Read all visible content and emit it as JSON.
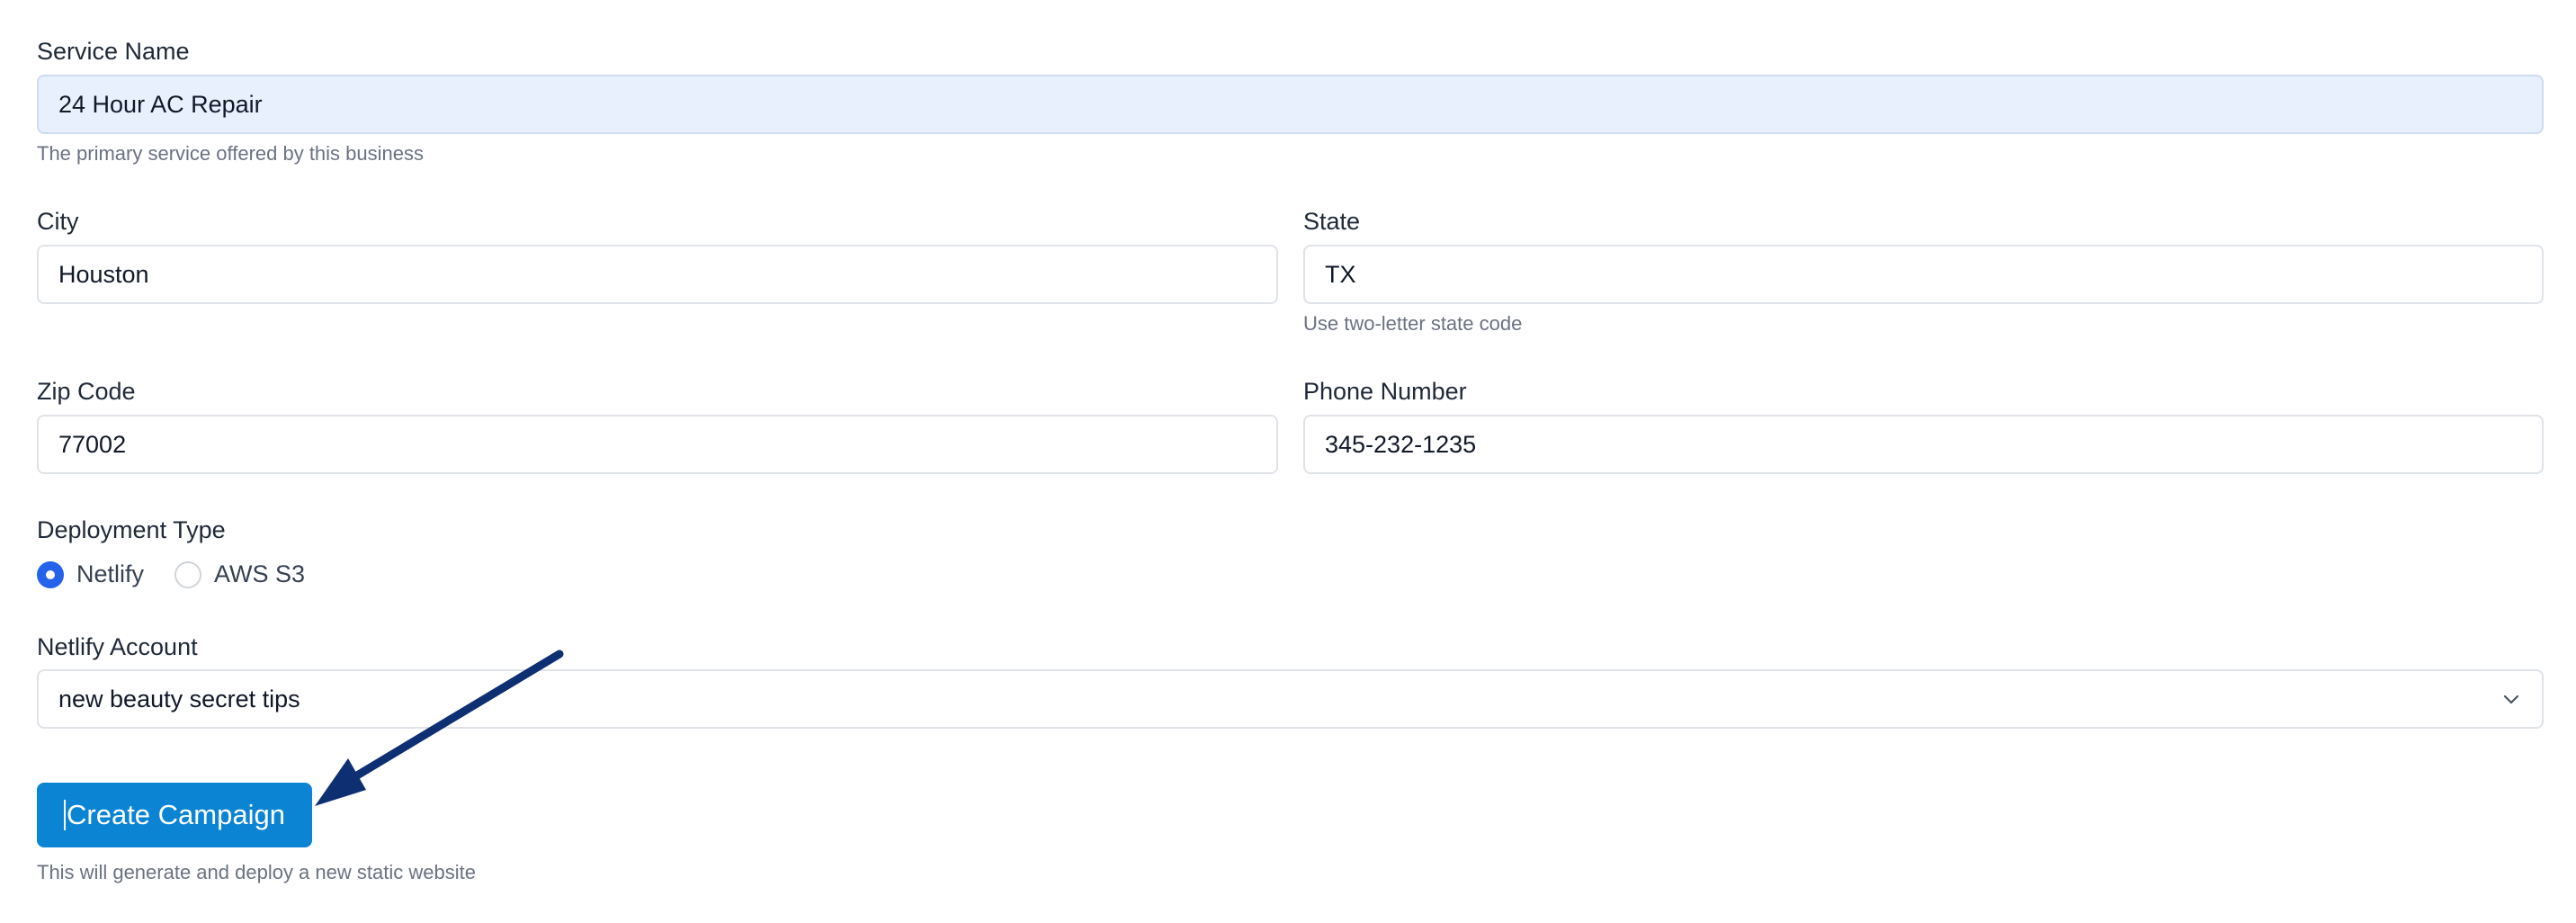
{
  "form": {
    "service_name": {
      "label": "Service Name",
      "value": "24 Hour AC Repair",
      "help": "The primary service offered by this business"
    },
    "city": {
      "label": "City",
      "value": "Houston"
    },
    "state": {
      "label": "State",
      "value": "TX",
      "help": "Use two-letter state code"
    },
    "zip_code": {
      "label": "Zip Code",
      "value": "77002"
    },
    "phone_number": {
      "label": "Phone Number",
      "value": "345-232-1235"
    },
    "deployment_type": {
      "label": "Deployment Type",
      "options": [
        {
          "label": "Netlify",
          "selected": true
        },
        {
          "label": "AWS S3",
          "selected": false
        }
      ]
    },
    "netlify_account": {
      "label": "Netlify Account",
      "selected": "new beauty secret tips"
    },
    "submit": {
      "label": "Create Campaign",
      "help": "This will generate and deploy a new static website"
    }
  },
  "colors": {
    "primary_button": "#0b84d4",
    "radio_checked": "#2563eb",
    "autofill_bg": "#e8f0fe",
    "annotation_arrow": "#0f2f73"
  },
  "icons": {
    "select_chevron": "chevron-down-icon",
    "annotation": "arrow-annotation-icon"
  }
}
